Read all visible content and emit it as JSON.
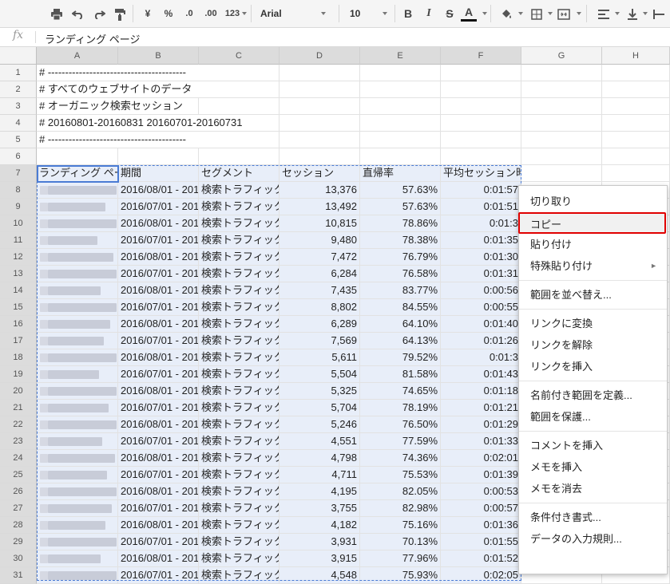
{
  "toolbar": {
    "currency": "¥",
    "percent": "%",
    "decrease_decimal": ".0",
    "increase_decimal": ".00",
    "format_more": "123",
    "font_family": "Arial",
    "font_size": "10",
    "bold": "B",
    "italic": "I",
    "strike": "S",
    "text_color": "A"
  },
  "formula_bar": {
    "fx": "fx",
    "value": "ランディング ページ"
  },
  "columns": [
    "A",
    "B",
    "C",
    "D",
    "E",
    "F",
    "G",
    "H"
  ],
  "rows": [
    {
      "n": "1",
      "a": "# ----------------------------------------"
    },
    {
      "n": "2",
      "a": "# すべてのウェブサイトのデータ"
    },
    {
      "n": "3",
      "a": "# オーガニック検索セッション"
    },
    {
      "n": "4",
      "a": "# 20160801-20160831 20160701-20160731"
    },
    {
      "n": "5",
      "a": "# ----------------------------------------"
    },
    {
      "n": "6",
      "a": ""
    },
    {
      "n": "7",
      "a": "ランディング ページ",
      "b": "期間",
      "c": "セグメント",
      "d": "セッション",
      "e": "直帰率",
      "f": "平均セッション時間"
    },
    {
      "n": "8",
      "b": "2016/08/01 - 201",
      "c": "検索トラフィック",
      "d": "13,376",
      "e": "57.63%",
      "f": "0:01:57"
    },
    {
      "n": "9",
      "b": "2016/07/01 - 201",
      "c": "検索トラフィック",
      "d": "13,492",
      "e": "57.63%",
      "f": "0:01:51"
    },
    {
      "n": "10",
      "b": "2016/08/01 - 201",
      "c": "検索トラフィック",
      "d": "10,815",
      "e": "78.86%",
      "f": "0:01:3"
    },
    {
      "n": "11",
      "b": "2016/07/01 - 201",
      "c": "検索トラフィック",
      "d": "9,480",
      "e": "78.38%",
      "f": "0:01:35"
    },
    {
      "n": "12",
      "b": "2016/08/01 - 201",
      "c": "検索トラフィック",
      "d": "7,472",
      "e": "76.79%",
      "f": "0:01:30"
    },
    {
      "n": "13",
      "b": "2016/07/01 - 201",
      "c": "検索トラフィック",
      "d": "6,284",
      "e": "76.58%",
      "f": "0:01:31"
    },
    {
      "n": "14",
      "b": "2016/08/01 - 201",
      "c": "検索トラフィック",
      "d": "7,435",
      "e": "83.77%",
      "f": "0:00:56"
    },
    {
      "n": "15",
      "b": "2016/07/01 - 201",
      "c": "検索トラフィック",
      "d": "8,802",
      "e": "84.55%",
      "f": "0:00:55"
    },
    {
      "n": "16",
      "b": "2016/08/01 - 201",
      "c": "検索トラフィック",
      "d": "6,289",
      "e": "64.10%",
      "f": "0:01:40"
    },
    {
      "n": "17",
      "b": "2016/07/01 - 201",
      "c": "検索トラフィック",
      "d": "7,569",
      "e": "64.13%",
      "f": "0:01:26"
    },
    {
      "n": "18",
      "b": "2016/08/01 - 201",
      "c": "検索トラフィック",
      "d": "5,611",
      "e": "79.52%",
      "f": "0:01:3"
    },
    {
      "n": "19",
      "b": "2016/07/01 - 201",
      "c": "検索トラフィック",
      "d": "5,504",
      "e": "81.58%",
      "f": "0:01:43"
    },
    {
      "n": "20",
      "b": "2016/08/01 - 201",
      "c": "検索トラフィック",
      "d": "5,325",
      "e": "74.65%",
      "f": "0:01:18"
    },
    {
      "n": "21",
      "b": "2016/07/01 - 201",
      "c": "検索トラフィック",
      "d": "5,704",
      "e": "78.19%",
      "f": "0:01:21"
    },
    {
      "n": "22",
      "b": "2016/08/01 - 201",
      "c": "検索トラフィック",
      "d": "5,246",
      "e": "76.50%",
      "f": "0:01:29"
    },
    {
      "n": "23",
      "b": "2016/07/01 - 201",
      "c": "検索トラフィック",
      "d": "4,551",
      "e": "77.59%",
      "f": "0:01:33"
    },
    {
      "n": "24",
      "b": "2016/08/01 - 201",
      "c": "検索トラフィック",
      "d": "4,798",
      "e": "74.36%",
      "f": "0:02:01"
    },
    {
      "n": "25",
      "b": "2016/07/01 - 201",
      "c": "検索トラフィック",
      "d": "4,711",
      "e": "75.53%",
      "f": "0:01:39"
    },
    {
      "n": "26",
      "b": "2016/08/01 - 201",
      "c": "検索トラフィック",
      "d": "4,195",
      "e": "82.05%",
      "f": "0:00:53"
    },
    {
      "n": "27",
      "b": "2016/07/01 - 201",
      "c": "検索トラフィック",
      "d": "3,755",
      "e": "82.98%",
      "f": "0:00:57"
    },
    {
      "n": "28",
      "b": "2016/08/01 - 201",
      "c": "検索トラフィック",
      "d": "4,182",
      "e": "75.16%",
      "f": "0:01:36"
    },
    {
      "n": "29",
      "b": "2016/07/01 - 201",
      "c": "検索トラフィック",
      "d": "3,931",
      "e": "70.13%",
      "f": "0:01:55"
    },
    {
      "n": "30",
      "b": "2016/08/01 - 201",
      "c": "検索トラフィック",
      "d": "3,915",
      "e": "77.96%",
      "f": "0:01:52"
    },
    {
      "n": "31",
      "b": "2016/07/01 - 201",
      "c": "検索トラフィック",
      "d": "4,548",
      "e": "75.93%",
      "f": "0:02:05"
    }
  ],
  "context_menu": {
    "items": [
      {
        "label": "切り取り"
      },
      {
        "label": "コピー",
        "highlighted": true
      },
      {
        "label": "貼り付け"
      },
      {
        "label": "特殊貼り付け",
        "submenu": true
      },
      {
        "label": "範囲を並べ替え..."
      },
      {
        "label": "リンクに変換"
      },
      {
        "label": "リンクを解除"
      },
      {
        "label": "リンクを挿入"
      },
      {
        "label": "名前付き範囲を定義..."
      },
      {
        "label": "範囲を保護..."
      },
      {
        "label": "コメントを挿入"
      },
      {
        "label": "メモを挿入"
      },
      {
        "label": "メモを消去"
      },
      {
        "label": "条件付き書式..."
      },
      {
        "label": "データの入力規則..."
      }
    ],
    "submenu_arrow": "►"
  },
  "colors": {
    "selection": "#e8eef9",
    "selection_border": "#4a7bd4",
    "highlight_border": "#e00000"
  }
}
